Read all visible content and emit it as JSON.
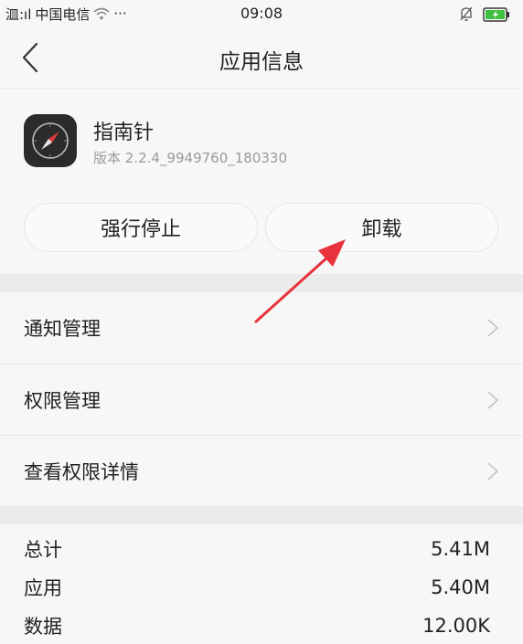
{
  "status_bar": {
    "carrier": "中国电信",
    "signal_text": "㳑:ıl",
    "more": "···",
    "time": "09:08"
  },
  "nav": {
    "title": "应用信息"
  },
  "app": {
    "name": "指南针",
    "version": "版本 2.2.4_9949760_180330"
  },
  "actions": {
    "force_stop_label": "强行停止",
    "uninstall_label": "卸载"
  },
  "menu": {
    "items": [
      {
        "label": "通知管理"
      },
      {
        "label": "权限管理"
      },
      {
        "label": "查看权限详情"
      }
    ]
  },
  "storage": {
    "rows": [
      {
        "label": "总计",
        "value": "5.41M"
      },
      {
        "label": "应用",
        "value": "5.40M"
      },
      {
        "label": "数据",
        "value": "12.00K"
      }
    ]
  },
  "colors": {
    "annotation_arrow": "#e8323c",
    "battery": "#3fbf3f"
  }
}
